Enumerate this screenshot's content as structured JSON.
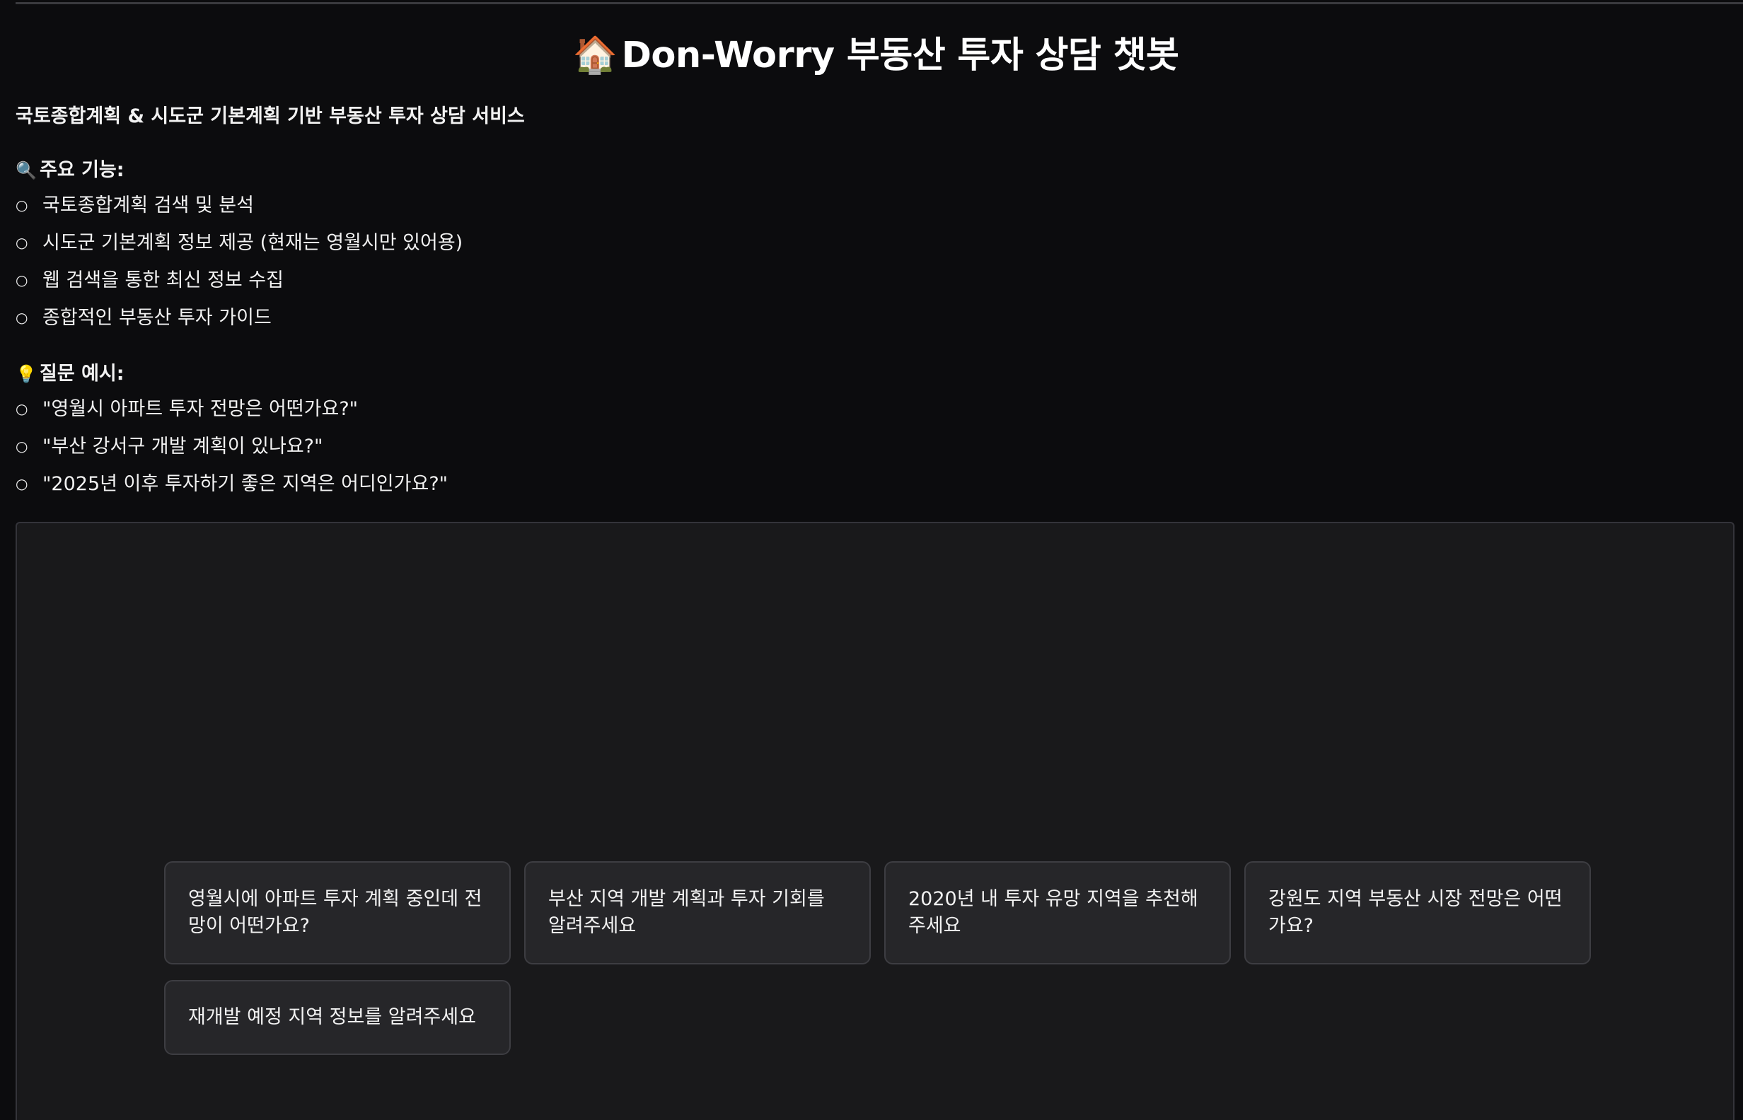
{
  "header": {
    "title_icon": "🏠",
    "title": "Don-Worry 부동산 투자 상담 챗봇",
    "subtitle": "국토종합계획 & 시도군 기본계획 기반 부동산 투자 상담 서비스"
  },
  "features": {
    "icon": "🔍",
    "heading": "주요 기능:",
    "items": [
      "국토종합계획 검색 및 분석",
      "시도군 기본계획 정보 제공 (현재는 영월시만 있어용)",
      "웹 검색을 통한 최신 정보 수집",
      "종합적인 부동산 투자 가이드"
    ]
  },
  "examples": {
    "icon": "💡",
    "heading": "질문 예시:",
    "items": [
      "\"영월시 아파트 투자 전망은 어떤가요?\"",
      "\"부산 강서구 개발 계획이 있나요?\"",
      "\"2025년 이후 투자하기 좋은 지역은 어디인가요?\""
    ]
  },
  "bullet_glyph": "○",
  "suggestions": [
    "영월시에 아파트 투자 계획 중인데 전망이 어떤가요?",
    "부산 지역 개발 계획과 투자 기회를 알려주세요",
    "2020년 내 투자 유망 지역을 추천해주세요",
    "강원도 지역 부동산 시장 전망은 어떤가요?",
    "재개발 예정 지역 정보를 알려주세요"
  ]
}
